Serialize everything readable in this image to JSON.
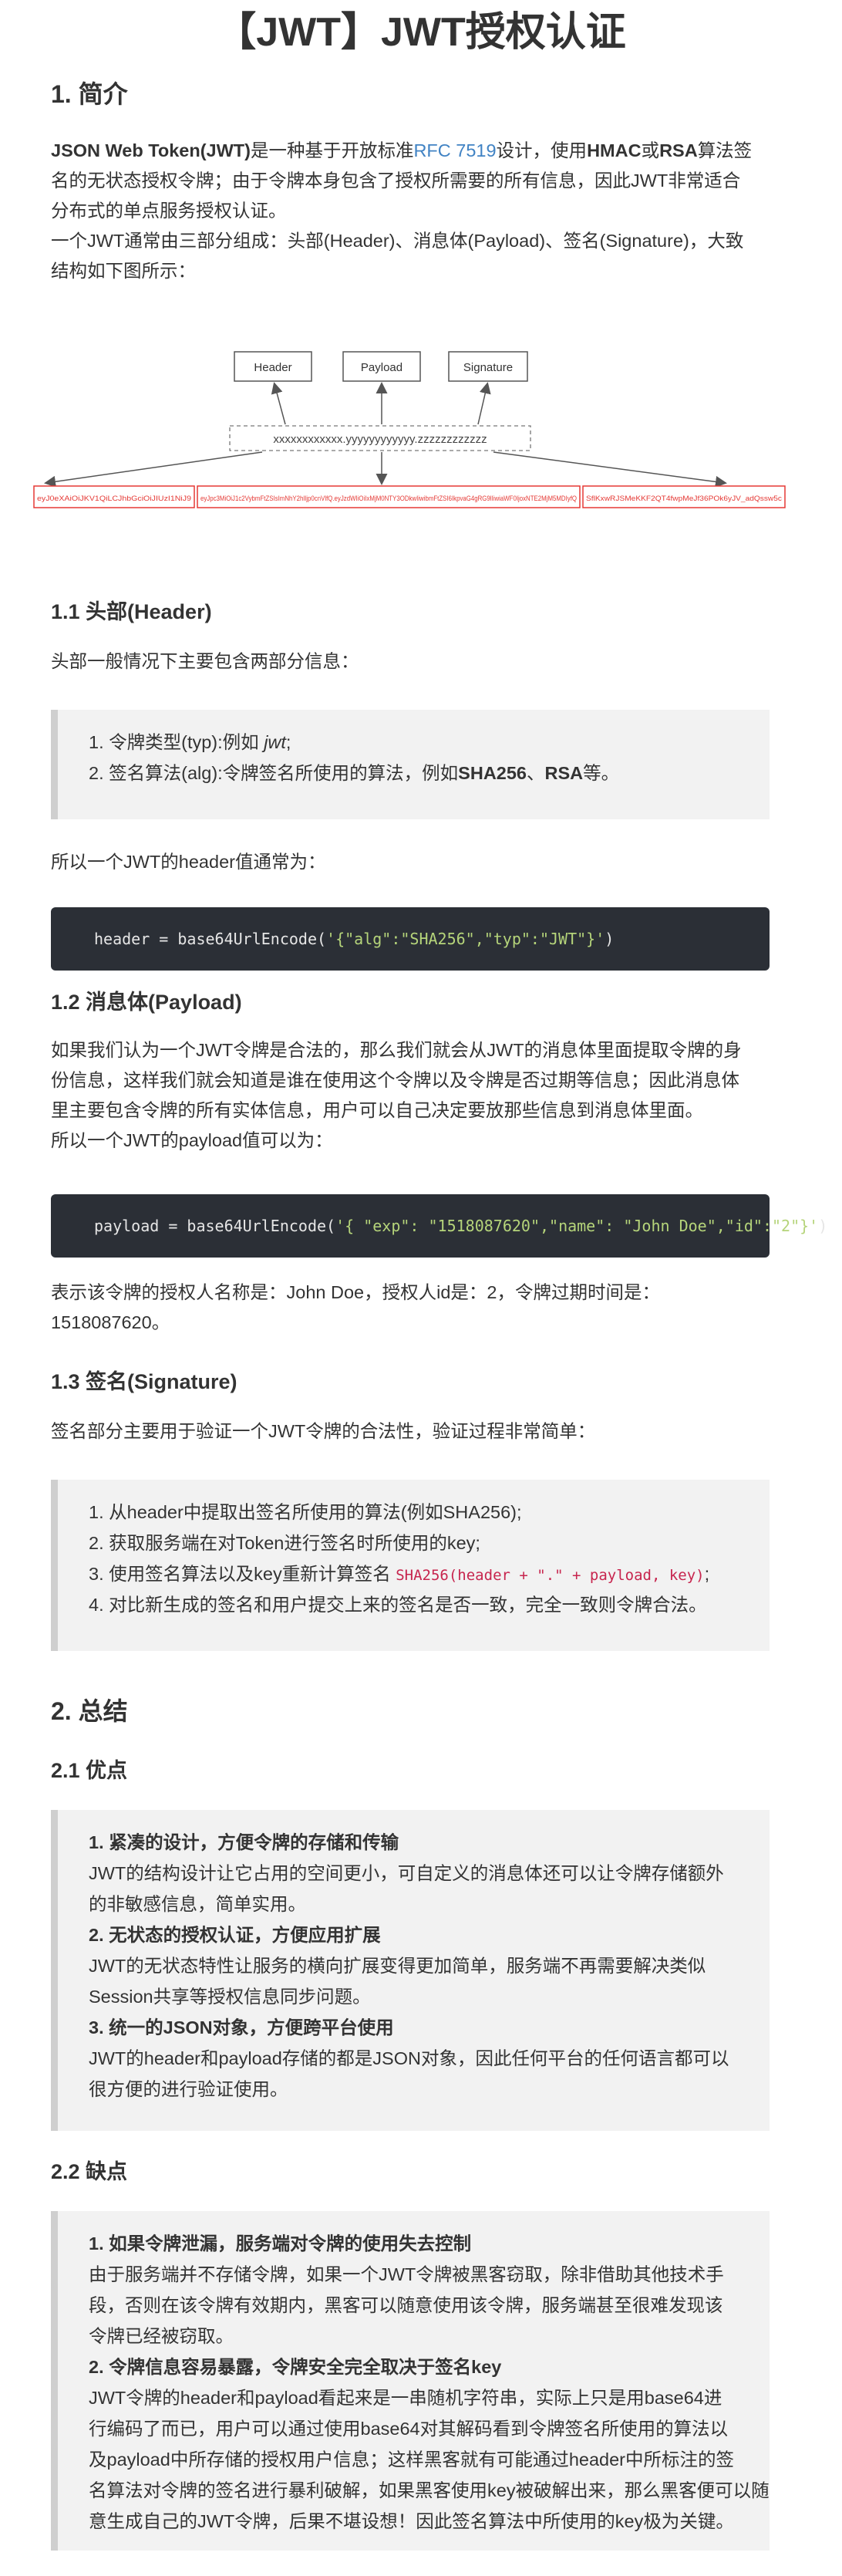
{
  "title": "【JWT】JWT授权认证",
  "s1": {
    "heading": "1. 简介",
    "p1a_bold": "JSON Web Token(JWT)",
    "p1a_text": "是一种基于开放标准",
    "p1a_link": "RFC 7519",
    "p1a_text2": "设计，使用",
    "p1a_bold2": "HMAC",
    "p1a_text3": "或",
    "p1a_bold3": "RSA",
    "p1a_text4": "算法签",
    "p1b": "名的无状态授权令牌；由于令牌本身包含了授权所需要的所有信息，因此JWT非常适合",
    "p1c": "分布式的单点服务授权认证。",
    "p2a": "一个JWT通常由三部分组成：头部(Header)、消息体(Payload)、签名(Signature)，大致",
    "p2b": "结构如下图所示："
  },
  "diagram": {
    "box_header": "Header",
    "box_payload": "Payload",
    "box_signature": "Signature",
    "structure": "xxxxxxxxxxxx.yyyyyyyyyyyy.zzzzzzzzzzzz",
    "token_header": "eyJ0eXAiOiJKV1QiLCJhbGciOiJIUzI1NiJ9",
    "token_payload": "eyJpc3MiOiJ1c2VybmFtZSIsImNhY2hlIjp0cnVlfQ.eyJzdWIiOiIxMjM0NTY3ODkwIiwibmFtZSI6IkpvaG4gRG9lIiwiaWF0IjoxNTE2MjM5MDIyfQ",
    "token_sig": "SflKxwRJSMeKKF2QT4fwpMeJf36POk6yJV_adQssw5c"
  },
  "s11": {
    "heading": "1.1 头部(Header)",
    "intro": "头部一般情况下主要包含两部分信息：",
    "item1_prefix": "1. 令牌类型(typ):例如 ",
    "item1_em": "jwt",
    "item1_suffix": ";",
    "item2_prefix": "2. 签名算法(alg):令牌签名所使用的算法，例如",
    "item2_b1": "SHA256",
    "item2_mid": "、",
    "item2_b2": "RSA",
    "item2_suffix": "等。",
    "after": "所以一个JWT的header值通常为：",
    "code_prefix": "header = base64UrlEncode(",
    "code_str": "'{\"alg\":\"SHA256\",\"typ\":\"JWT\"}'",
    "code_suffix": ")"
  },
  "s12": {
    "heading": "1.2 消息体(Payload)",
    "p1": "如果我们认为一个JWT令牌是合法的，那么我们就会从JWT的消息体里面提取令牌的身",
    "p2": "份信息，这样我们就会知道是谁在使用这个令牌以及令牌是否过期等信息；因此消息体",
    "p3": "里主要包含令牌的所有实体信息，用户可以自己决定要放那些信息到消息体里面。",
    "p4": "所以一个JWT的payload值可以为：",
    "code_prefix": "payload = base64UrlEncode(",
    "code_str": "'{ \"exp\": \"1518087620\",\"name\": \"John Doe\",\"id\":\"2\"}'",
    "code_suffix": ")",
    "after1": "表示该令牌的授权人名称是：John Doe，授权人id是：2，令牌过期时间是：",
    "after2": "1518087620。"
  },
  "s13": {
    "heading": "1.3 签名(Signature)",
    "intro": "签名部分主要用于验证一个JWT令牌的合法性，验证过程非常简单：",
    "item1": "1. 从header中提取出签名所使用的算法(例如SHA256);",
    "item2": "2. 获取服务端在对Token进行签名时所使用的key;",
    "item3_prefix": "3. 使用签名算法以及key重新计算签名 ",
    "item3_code": "SHA256(header + \".\" + payload, key)",
    "item3_suffix": ";",
    "item4": "4. 对比新生成的签名和用户提交上来的签名是否一致，完全一致则令牌合法。"
  },
  "s2": {
    "heading": "2. 总结",
    "sub1": "2.1 优点",
    "pro1_title": "1. 紧凑的设计，方便令牌的存储和传输",
    "pro1_l1": "JWT的结构设计让它占用的空间更小，可自定义的消息体还可以让令牌存储额外",
    "pro1_l2": "的非敏感信息，简单实用。",
    "pro2_title": "2. 无状态的授权认证，方便应用扩展",
    "pro2_l1": "JWT的无状态特性让服务的横向扩展变得更加简单，服务端不再需要解决类似",
    "pro2_l2": "Session共享等授权信息同步问题。",
    "pro3_title": "3. 统一的JSON对象，方便跨平台使用",
    "pro3_l1": "JWT的header和payload存储的都是JSON对象，因此任何平台的任何语言都可以",
    "pro3_l2": "很方便的进行验证使用。",
    "sub2": "2.2 缺点",
    "con1_title": "1. 如果令牌泄漏，服务端对令牌的使用失去控制",
    "con1_l1": "由于服务端并不存储令牌，如果一个JWT令牌被黑客窃取，除非借助其他技术手",
    "con1_l2": "段，否则在该令牌有效期内，黑客可以随意使用该令牌，服务端甚至很难发现该",
    "con1_l3": "令牌已经被窃取。",
    "con2_title": "2. 令牌信息容易暴露，令牌安全完全取决于签名key",
    "con2_l1": "JWT令牌的header和payload看起来是一串随机字符串，实际上只是用base64进",
    "con2_l2": "行编码了而已，用户可以通过使用base64对其解码看到令牌签名所使用的算法以",
    "con2_l3": "及payload中所存储的授权用户信息；这样黑客就有可能通过header中所标注的签",
    "con2_l4": "名算法对令牌的签名进行暴利破解，如果黑客使用key被破解出来，那么黑客便可以随",
    "con2_l5": "意生成自己的JWT令牌，后果不堪设想！因此签名算法中所使用的key极为关键。"
  }
}
